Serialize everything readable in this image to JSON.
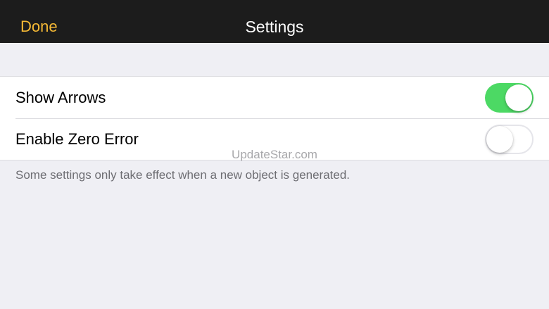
{
  "navbar": {
    "done_label": "Done",
    "title": "Settings",
    "accent_color": "#f5b935"
  },
  "settings": {
    "rows": [
      {
        "label": "Show Arrows",
        "enabled": true
      },
      {
        "label": "Enable Zero Error",
        "enabled": false
      }
    ],
    "footer_note": "Some settings only take effect when a new object is generated.",
    "toggle_on_color": "#4cd964"
  },
  "watermark": "UpdateStar.com"
}
